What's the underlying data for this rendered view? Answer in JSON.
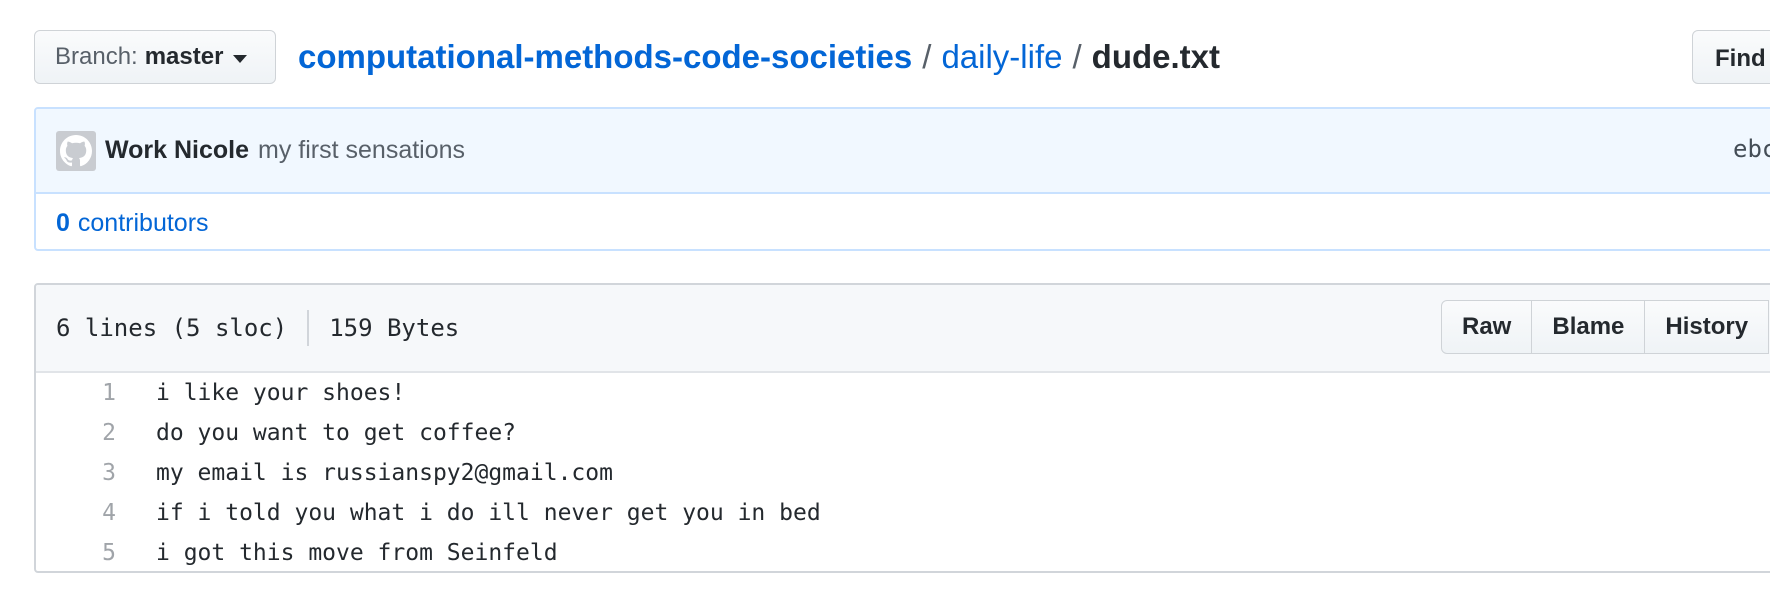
{
  "branch": {
    "label": "Branch:",
    "value": "master"
  },
  "breadcrumb": {
    "repo": "computational-methods-code-societies",
    "separator": "/",
    "dir": "daily-life",
    "file": "dude.txt"
  },
  "find_button": "Find",
  "commit": {
    "author": "Work Nicole",
    "message": "my first sensations",
    "sha": "ebc"
  },
  "contributors": {
    "count": "0",
    "label": "contributors"
  },
  "file": {
    "lines_info": "6 lines (5 sloc)",
    "size": "159 Bytes",
    "buttons": {
      "raw": "Raw",
      "blame": "Blame",
      "history": "History"
    },
    "lines": [
      {
        "num": "1",
        "text": "i like your shoes!"
      },
      {
        "num": "2",
        "text": "do you want to get coffee?"
      },
      {
        "num": "3",
        "text": "my email is russianspy2@gmail.com"
      },
      {
        "num": "4",
        "text": "if i told you what i do ill never get you in bed"
      },
      {
        "num": "5",
        "text": "i got this move from Seinfeld"
      }
    ]
  },
  "icons": {
    "avatar": "github-octocat-icon",
    "caret": "caret-down-icon"
  }
}
